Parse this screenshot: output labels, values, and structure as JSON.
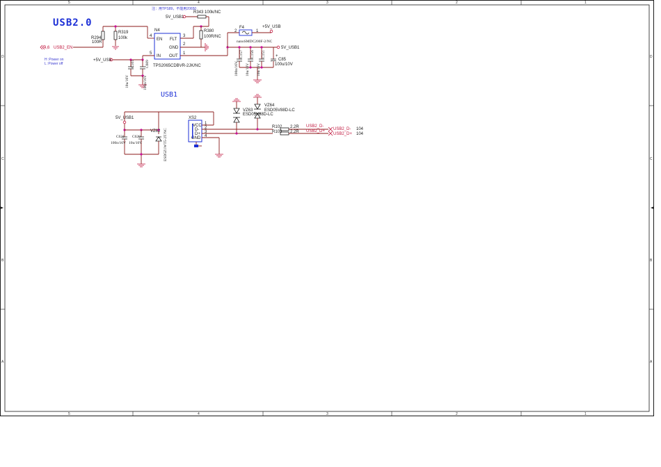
{
  "sheet": {
    "col_labels_top": [
      "5",
      "4",
      "3",
      "2",
      "1"
    ],
    "col_labels_bottom": [
      "5",
      "4",
      "3",
      "2",
      "1"
    ],
    "row_labels": [
      "D",
      "C",
      "B",
      "A"
    ]
  },
  "titles": {
    "usb20": "USB2.0",
    "usb1": "USB1"
  },
  "notes": {
    "top_note": "注：用TPS89，不能用20650",
    "en_note_1": "H :Power on",
    "en_note_2": "L :Power off"
  },
  "nets": {
    "usb2_en": "USB2_EN",
    "usb2_en_ref": "4,6",
    "v5_usb1_top": "5V_USB1",
    "v5_usb": "+5V_USB",
    "v5_usb_in": "+5V_USB",
    "v5_usb1_out": "5V_USB1",
    "v5_usb1_left": "5V_USB1",
    "usb2_dm": "USB2_D-",
    "usb2_dp": "USB2_D+",
    "usb2_dm_ref": "104",
    "usb2_dp_ref": "104",
    "d_minus_local": "USB2_D-",
    "d_plus_local": "USB2_D+"
  },
  "components": {
    "R343": {
      "ref": "R343",
      "value": "100k/NC"
    },
    "R294": {
      "ref": "R294",
      "value": "100R"
    },
    "R319": {
      "ref": "R319",
      "value": "100k"
    },
    "R380": {
      "ref": "R380",
      "value": "100R/NC"
    },
    "N4": {
      "ref": "N4",
      "value": "TPS2065CDBVR-2JK/NC",
      "pins": {
        "en": "EN",
        "flt": "FLT",
        "gnd": "GND",
        "in": "IN",
        "out": "OUT",
        "p1": "1",
        "p2": "2",
        "p3": "3",
        "p4": "4",
        "p5": "5"
      }
    },
    "F4": {
      "ref": "F4",
      "value": "nanoSMDC200F-2/NC",
      "pin1": "1",
      "pin2": "2"
    },
    "C157": {
      "ref": "C157",
      "value": "100n/16V"
    },
    "C156": {
      "ref": "C156",
      "value": "10u/10V"
    },
    "C151": {
      "ref": "C151",
      "value": "10u/10V"
    },
    "C85": {
      "ref": "C85",
      "value": "100u/10V"
    },
    "C101": {
      "ref": "C101",
      "value": "10u/16V"
    },
    "C609": {
      "ref": "C609",
      "value": "100n/16V"
    },
    "VZ63": {
      "ref": "VZ63",
      "value": "ESD05V88D-LC"
    },
    "VZ64": {
      "ref": "VZ64",
      "value": "ESD05V88D-LC"
    },
    "XS2": {
      "ref": "XS2",
      "pins": [
        "VCC",
        "D-",
        "D+",
        "GND"
      ],
      "pin_nums": [
        "1",
        "2",
        "3",
        "4"
      ]
    },
    "R102": {
      "ref": "R102",
      "value": "2.2R"
    },
    "R103": {
      "ref": "R103",
      "value": "2.2R"
    },
    "C621": {
      "ref": "C621",
      "value": "100n/16V"
    },
    "C620": {
      "ref": "C620",
      "value": "10u/10V"
    },
    "VZ62": {
      "ref": "VZ62",
      "value": "ESD5Z1WT5-2T/NC"
    }
  },
  "colors": {
    "title_blue": "#1c2fd6",
    "wire_dark_red": "#8b1a1a",
    "net_red": "#c0143c",
    "junction_magenta": "#c8109a",
    "border": "#1a1a1a"
  }
}
